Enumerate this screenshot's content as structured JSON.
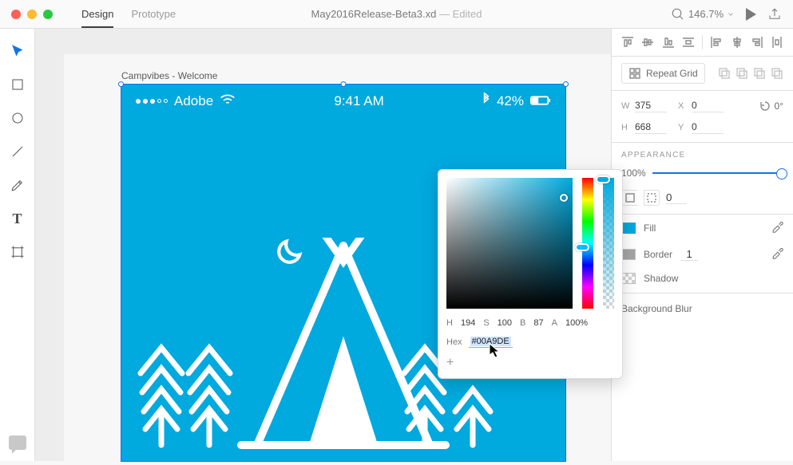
{
  "window": {
    "filename": "May2016Release-Beta3.xd",
    "edited_suffix": " — Edited",
    "zoom": "146.7%"
  },
  "tabs": {
    "design": "Design",
    "prototype": "Prototype",
    "active": "design"
  },
  "tools": [
    {
      "name": "select",
      "active": true
    },
    {
      "name": "rectangle"
    },
    {
      "name": "ellipse"
    },
    {
      "name": "line"
    },
    {
      "name": "pen"
    },
    {
      "name": "text",
      "glyph": "T"
    },
    {
      "name": "artboard"
    }
  ],
  "artboard": {
    "label": "Campvibes - Welcome",
    "color": "#00A9DE",
    "status": {
      "carrier": "Adobe",
      "time": "9:41 AM",
      "battery": "42%"
    }
  },
  "transform": {
    "w": "375",
    "h": "668",
    "x": "0",
    "y": "0",
    "rotation": "0°"
  },
  "repeat_grid_label": "Repeat Grid",
  "appearance": {
    "title": "APPEARANCE",
    "opacity": "100%",
    "blend_value": "0",
    "fill": {
      "label": "Fill",
      "swatch": "#00A9DE"
    },
    "border": {
      "label": "Border",
      "width": "1"
    },
    "shadow": {
      "label": "Shadow"
    },
    "blur": {
      "label": "Background Blur"
    }
  },
  "picker": {
    "h_label": "H",
    "h": "194",
    "s_label": "S",
    "s": "100",
    "b_label": "B",
    "b": "87",
    "a_label": "A",
    "a": "100%",
    "hex_label": "Hex",
    "hex": "#00A9DE"
  }
}
